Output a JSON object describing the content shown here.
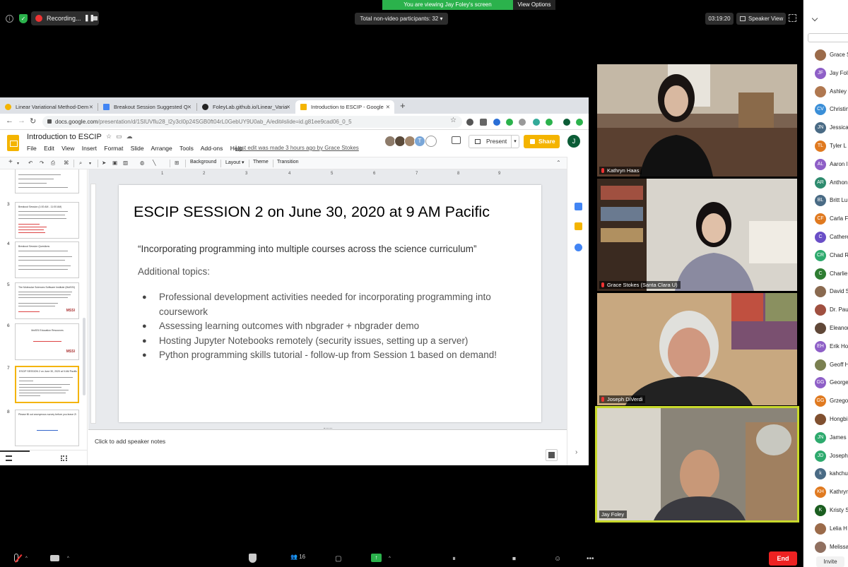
{
  "zoom": {
    "recording_label": "Recording...",
    "viewing_banner": "You are viewing Jay Foley's screen",
    "view_options": "View Options",
    "nonvideo_participants": "Total non-video participants: 32",
    "timer": "03:19:20",
    "speaker_view": "Speaker View",
    "participant_count": "16",
    "end_label": "End",
    "invite_label": "Invite",
    "colors": {
      "green": "#2bb24c",
      "red": "#e22222",
      "active_speaker": "#c8d92b"
    }
  },
  "browser": {
    "tabs": [
      {
        "label": "Linear Variational Method-Dem",
        "favicon_color": "#f4b400"
      },
      {
        "label": "Breakout Session Suggested Q",
        "favicon_color": "#4285f4"
      },
      {
        "label": "FoleyLab.github.io/Linear_Varia",
        "favicon_color": "#222222"
      },
      {
        "label": "Introduction to ESCIP - Google",
        "favicon_color": "#f4b400"
      }
    ],
    "url_host": "docs.google.com",
    "url_path": "/presentation/d/1SlUVflu28_l2y3cl0p24SGB0ft04rL0GebUY9U0ab_A/edit#slide=id.g81ee9cad06_0_5"
  },
  "slides": {
    "doc_title": "Introduction to ESCIP",
    "menu": [
      "File",
      "Edit",
      "View",
      "Insert",
      "Format",
      "Slide",
      "Arrange",
      "Tools",
      "Add-ons",
      "Help"
    ],
    "last_edit": "Last edit was made 3 hours ago by Grace Stokes",
    "present_label": "Present",
    "share_label": "Share",
    "user_initial": "J",
    "collaborators": [
      {
        "initial": "",
        "color": "#8d7b6a"
      },
      {
        "initial": "",
        "color": "#5a4a3a"
      },
      {
        "initial": "",
        "color": "#a0856b"
      },
      {
        "initial": "T",
        "color": "#7aa7d8"
      }
    ],
    "toolbar": {
      "background": "Background",
      "layout": "Layout",
      "theme": "Theme",
      "transition": "Transition"
    },
    "ruler_ticks": [
      "1",
      "2",
      "3",
      "4",
      "5",
      "6",
      "7",
      "8",
      "9"
    ],
    "thumbnails": [
      {
        "num": "3",
        "title": "Breakout Session (1:00 AM - 11:00 AM)"
      },
      {
        "num": "4",
        "title": "Breakout Session Questions"
      },
      {
        "num": "5",
        "title": "The Molecular Sciences Software Institute (MolSSI)"
      },
      {
        "num": "6",
        "title": "MolSSI Education Resources"
      },
      {
        "num": "7",
        "title": "ESCIP SESSION 2 on June 30, 2020 at 9 AM Pacific"
      },
      {
        "num": "8",
        "title": "Please fill out anonymous survey before you leave ZOOM"
      }
    ],
    "current_slide": {
      "title": "ESCIP SESSION 2 on June 30, 2020 at 9 AM Pacific",
      "subtitle": "“Incorporating programming into multiple courses across the science curriculum”",
      "additional": "Additional topics:",
      "bullets": [
        "Professional development activities needed for incorporating programming into coursework",
        "Assessing learning outcomes with nbgrader + nbgrader demo",
        "Hosting Jupyter Notebooks remotely (security issues, setting up a server)",
        "Python programming skills tutorial - follow-up from Session 1 based on demand!"
      ]
    },
    "speaker_notes_placeholder": "Click to add speaker notes"
  },
  "videos": [
    {
      "name": "Kathryn Haas",
      "muted": true
    },
    {
      "name": "Grace Stokes (Santa Clara U)",
      "muted": true
    },
    {
      "name": "Joseph DiVerdi",
      "muted": true
    },
    {
      "name": "Jay Foley",
      "muted": false
    }
  ],
  "participants": [
    {
      "initials": "",
      "name": "Grace S",
      "color": "#9b6b4a"
    },
    {
      "initials": "JF",
      "name": "Jay Fol",
      "color": "#8e5fc7"
    },
    {
      "initials": "",
      "name": "Ashley",
      "color": "#b07850"
    },
    {
      "initials": "CV",
      "name": "Christin",
      "color": "#3b8fd8"
    },
    {
      "initials": "JN",
      "name": "Jessica",
      "color": "#4a6b85"
    },
    {
      "initials": "TL",
      "name": "Tyler L",
      "color": "#e07a20"
    },
    {
      "initials": "AL",
      "name": "Aaron l",
      "color": "#8e5fc7"
    },
    {
      "initials": "AR",
      "name": "Anthon",
      "color": "#2e8b6e"
    },
    {
      "initials": "BL",
      "name": "Britt Lu",
      "color": "#4a6b85"
    },
    {
      "initials": "CF",
      "name": "Carla F",
      "color": "#e07a20"
    },
    {
      "initials": "C",
      "name": "Cathere",
      "color": "#6a4fc7"
    },
    {
      "initials": "CR",
      "name": "Chad R",
      "color": "#2eaa6e"
    },
    {
      "initials": "C",
      "name": "Charlie",
      "color": "#2e7d32"
    },
    {
      "initials": "",
      "name": "David S",
      "color": "#8a6a50"
    },
    {
      "initials": "",
      "name": "Dr. Pau",
      "color": "#a05040"
    },
    {
      "initials": "",
      "name": "Eleanor",
      "color": "#604838"
    },
    {
      "initials": "EH",
      "name": "Erik Ho",
      "color": "#8e5fc7"
    },
    {
      "initials": "",
      "name": "Geoff H",
      "color": "#7a8050"
    },
    {
      "initials": "GG",
      "name": "George",
      "color": "#8e5fc7"
    },
    {
      "initials": "GG",
      "name": "Grzego",
      "color": "#e07a20"
    },
    {
      "initials": "",
      "name": "Hongbi",
      "color": "#805030"
    },
    {
      "initials": "JN",
      "name": "James",
      "color": "#2eaa6e"
    },
    {
      "initials": "JD",
      "name": "Joseph",
      "color": "#2eaa6e"
    },
    {
      "initials": "k",
      "name": "kahchu",
      "color": "#4a6b85"
    },
    {
      "initials": "KH",
      "name": "Kathryn",
      "color": "#e07a20"
    },
    {
      "initials": "K",
      "name": "Kristy S",
      "color": "#1b5e20"
    },
    {
      "initials": "",
      "name": "Lelia H",
      "color": "#9b6b4a"
    },
    {
      "initials": "",
      "name": "Melissa",
      "color": "#907060"
    }
  ]
}
